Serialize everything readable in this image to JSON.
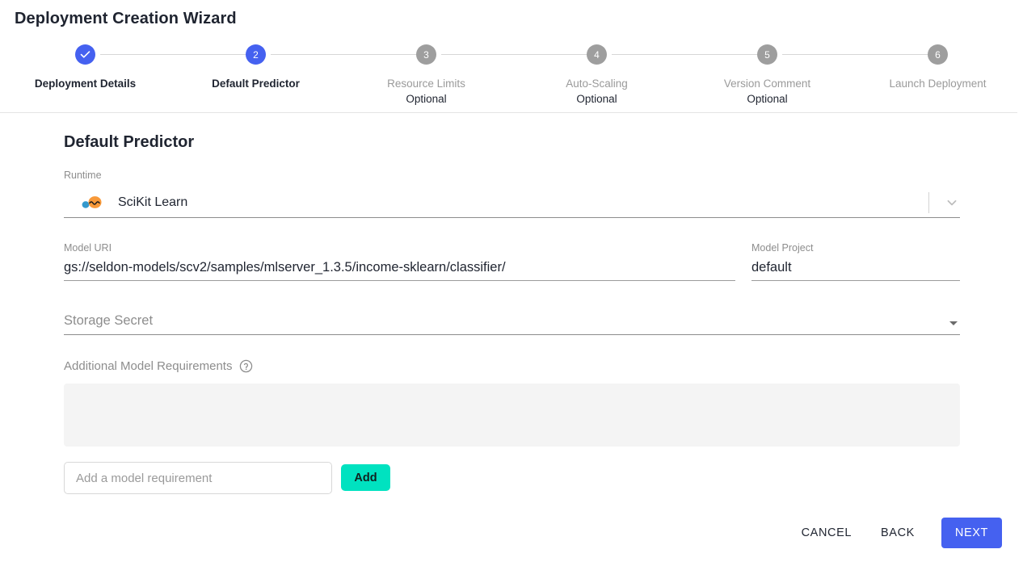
{
  "header": {
    "title": "Deployment Creation Wizard"
  },
  "stepper": {
    "steps": [
      {
        "num": "1",
        "label": "Deployment Details",
        "optional": "",
        "state": "done",
        "icon": "check-icon"
      },
      {
        "num": "2",
        "label": "Default Predictor",
        "optional": "",
        "state": "active",
        "icon": ""
      },
      {
        "num": "3",
        "label": "Resource Limits",
        "optional": "Optional",
        "state": "todo",
        "icon": ""
      },
      {
        "num": "4",
        "label": "Auto-Scaling",
        "optional": "Optional",
        "state": "todo",
        "icon": ""
      },
      {
        "num": "5",
        "label": "Version Comment",
        "optional": "Optional",
        "state": "todo",
        "icon": ""
      },
      {
        "num": "6",
        "label": "Launch Deployment",
        "optional": "",
        "state": "todo",
        "icon": ""
      }
    ]
  },
  "form": {
    "section_title": "Default Predictor",
    "runtime": {
      "label": "Runtime",
      "value": "SciKit Learn",
      "icon": "scikit-learn-logo",
      "dropdown_icon": "chevron-down-icon"
    },
    "model_uri": {
      "label": "Model URI",
      "value": "gs://seldon-models/scv2/samples/mlserver_1.3.5/income-sklearn/classifier/"
    },
    "model_project": {
      "label": "Model Project",
      "value": "default"
    },
    "storage_secret": {
      "placeholder": "Storage Secret",
      "value": "",
      "dropdown_icon": "caret-down-icon"
    },
    "requirements": {
      "title": "Additional Model Requirements",
      "help_icon": "help-circle-icon",
      "items": [],
      "input_placeholder": "Add a model requirement",
      "input_value": "",
      "add_label": "Add"
    }
  },
  "footer": {
    "cancel_label": "CANCEL",
    "back_label": "BACK",
    "next_label": "NEXT"
  },
  "colors": {
    "accent_blue": "#4561f0",
    "accent_teal": "#00e2c0",
    "step_inactive": "#9e9e9e",
    "panel_gray": "#f4f4f4"
  }
}
